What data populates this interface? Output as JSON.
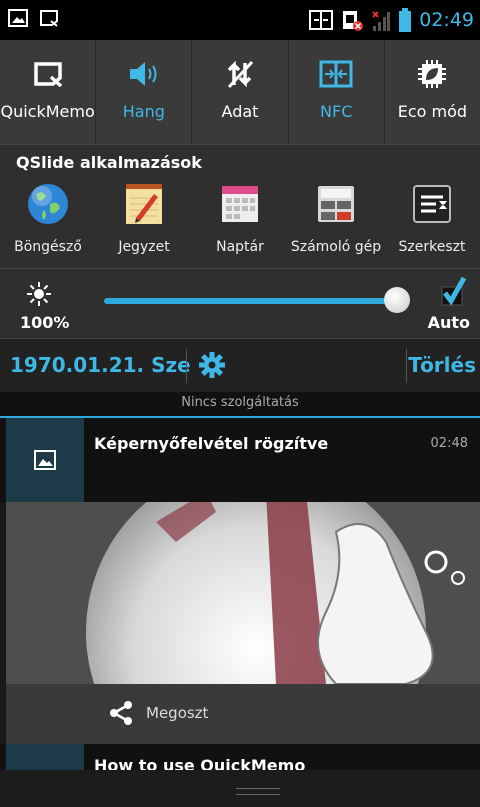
{
  "status_bar": {
    "time": "02:49",
    "left_icons": [
      "screenshot-icon",
      "quickmemo-icon"
    ],
    "right_icons": [
      "nfc-icon",
      "sim-error-icon",
      "no-signal-icon",
      "battery-icon"
    ]
  },
  "quick_toggles": [
    {
      "label": "QuickMemo",
      "icon": "quickmemo-icon",
      "active": false
    },
    {
      "label": "Hang",
      "icon": "speaker-icon",
      "active": true
    },
    {
      "label": "Adat",
      "icon": "data-off-icon",
      "active": false
    },
    {
      "label": "NFC",
      "icon": "nfc-icon",
      "active": true
    },
    {
      "label": "Eco mód",
      "icon": "eco-chip-icon",
      "active": false
    }
  ],
  "qslide": {
    "title": "QSlide  alkalmazások",
    "apps": [
      {
        "label": "Böngésző",
        "icon": "globe-icon"
      },
      {
        "label": "Jegyzet",
        "icon": "notepad-icon"
      },
      {
        "label": "Naptár",
        "icon": "calendar-icon"
      },
      {
        "label": "Számoló gép",
        "icon": "calculator-icon"
      },
      {
        "label": "Szerkeszt",
        "icon": "edit-list-icon"
      }
    ]
  },
  "brightness": {
    "percent_label": "100%",
    "level": 0.95,
    "auto_label": "Auto",
    "auto_checked": true
  },
  "date_bar": {
    "date": "1970.01.21. Sze",
    "clear_label": "Törlés"
  },
  "no_service": "Nincs szolgáltatás",
  "notification": {
    "title": "Képernyőfelvétel rögzítve",
    "time": "02:48"
  },
  "share_label": "Megoszt",
  "notification2": {
    "title": "How to use QuickMemo"
  },
  "colors": {
    "accent": "#3fb8e6",
    "panel": "#3a3a3a",
    "background": "#1a1a1a"
  }
}
